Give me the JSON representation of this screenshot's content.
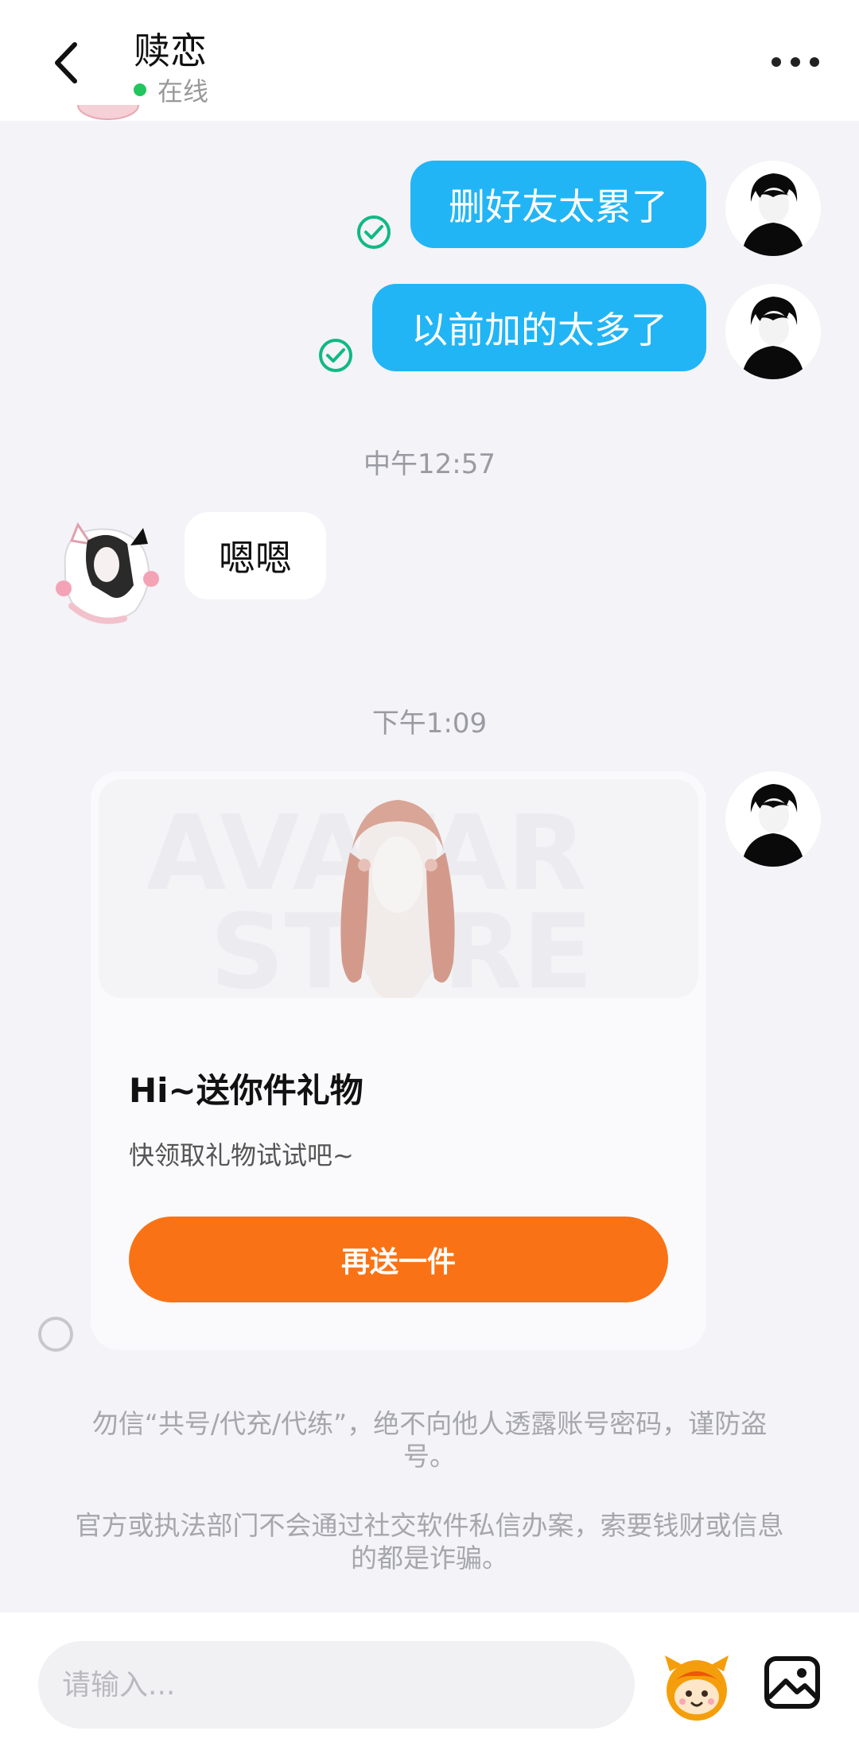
{
  "header": {
    "title": "赎恋",
    "status": "在线",
    "status_color": "#22c55e"
  },
  "messages": [
    {
      "side": "right",
      "text": "删好友太累了",
      "read": true
    },
    {
      "side": "right",
      "text": "以前加的太多了",
      "read": true
    },
    {
      "timestamp": "中午12:57"
    },
    {
      "side": "left",
      "text": "嗯嗯"
    },
    {
      "timestamp": "下午1:09"
    }
  ],
  "gift_card": {
    "watermark_line1": "AVATAR",
    "watermark_line2": "STORE",
    "title": "Hi~送你件礼物",
    "subtitle": "快领取礼物试试吧~",
    "button_label": "再送一件",
    "button_color": "#f97316"
  },
  "notices": [
    "勿信“共号/代充/代练”，绝不向他人透露账号密码，谨防盗号。",
    "官方或执法部门不会通过社交软件私信办案，索要钱财或信息的都是诈骗。"
  ],
  "input": {
    "placeholder": "请输入..."
  },
  "icons": {
    "back": "chevron-left-icon",
    "more": "more-dots-icon",
    "read": "check-circle-icon",
    "emoji": "mascot-emoji-icon",
    "image": "image-icon"
  },
  "colors": {
    "bubble_sent": "#22b5f5",
    "bubble_received": "#ffffff",
    "read_check": "#10b981"
  }
}
